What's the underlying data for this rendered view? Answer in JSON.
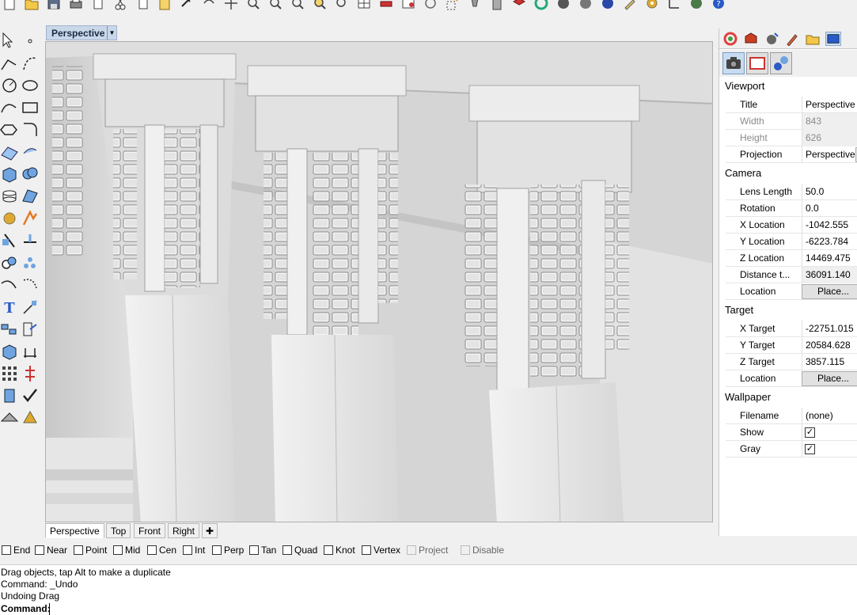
{
  "viewport": {
    "title": "Perspective",
    "dropdown_icon": "caret-down-icon"
  },
  "viewport_tabs": [
    "Perspective",
    "Top",
    "Front",
    "Right"
  ],
  "osnaps": [
    {
      "label": "End",
      "checked": false,
      "enabled": true
    },
    {
      "label": "Near",
      "checked": false,
      "enabled": true
    },
    {
      "label": "Point",
      "checked": false,
      "enabled": true
    },
    {
      "label": "Mid",
      "checked": false,
      "enabled": true
    },
    {
      "label": "Cen",
      "checked": false,
      "enabled": true
    },
    {
      "label": "Int",
      "checked": false,
      "enabled": true
    },
    {
      "label": "Perp",
      "checked": false,
      "enabled": true
    },
    {
      "label": "Tan",
      "checked": false,
      "enabled": true
    },
    {
      "label": "Quad",
      "checked": false,
      "enabled": true
    },
    {
      "label": "Knot",
      "checked": false,
      "enabled": true
    },
    {
      "label": "Vertex",
      "checked": false,
      "enabled": true
    },
    {
      "label": "Project",
      "checked": false,
      "enabled": false
    },
    {
      "label": "Disable",
      "checked": false,
      "enabled": false
    }
  ],
  "command": {
    "history": [
      "Drag objects, tap Alt to make a duplicate",
      "Command: _Undo",
      "Undoing Drag"
    ],
    "prompt": "Command:",
    "input": ""
  },
  "panel": {
    "viewport_section": "Viewport",
    "viewport_rows": [
      {
        "label": "Title",
        "value": "Perspective"
      },
      {
        "label": "Width",
        "value": "843"
      },
      {
        "label": "Height",
        "value": "626"
      },
      {
        "label": "Projection",
        "value": "Perspective"
      }
    ],
    "camera_section": "Camera",
    "camera_rows": [
      {
        "label": "Lens Length",
        "value": "50.0"
      },
      {
        "label": "Rotation",
        "value": "0.0"
      },
      {
        "label": "X Location",
        "value": "-1042.555"
      },
      {
        "label": "Y Location",
        "value": "-6223.784"
      },
      {
        "label": "Z Location",
        "value": "14469.475"
      },
      {
        "label": "Distance t...",
        "value": "36091.140"
      },
      {
        "label": "Location",
        "value": "Place..."
      }
    ],
    "target_section": "Target",
    "target_rows": [
      {
        "label": "X Target",
        "value": "-22751.015"
      },
      {
        "label": "Y Target",
        "value": "20584.628"
      },
      {
        "label": "Z Target",
        "value": "3857.115"
      },
      {
        "label": "Location",
        "value": "Place..."
      }
    ],
    "wallpaper_section": "Wallpaper",
    "wallpaper_rows": [
      {
        "label": "Filename",
        "value": "(none)"
      },
      {
        "label": "Show",
        "checked": true
      },
      {
        "label": "Gray",
        "checked": true
      }
    ],
    "browse_label": ".."
  },
  "colors": {
    "accent": "#c9d7ea",
    "panel_bg": "#ffffff",
    "chrome": "#f0f0f0"
  }
}
